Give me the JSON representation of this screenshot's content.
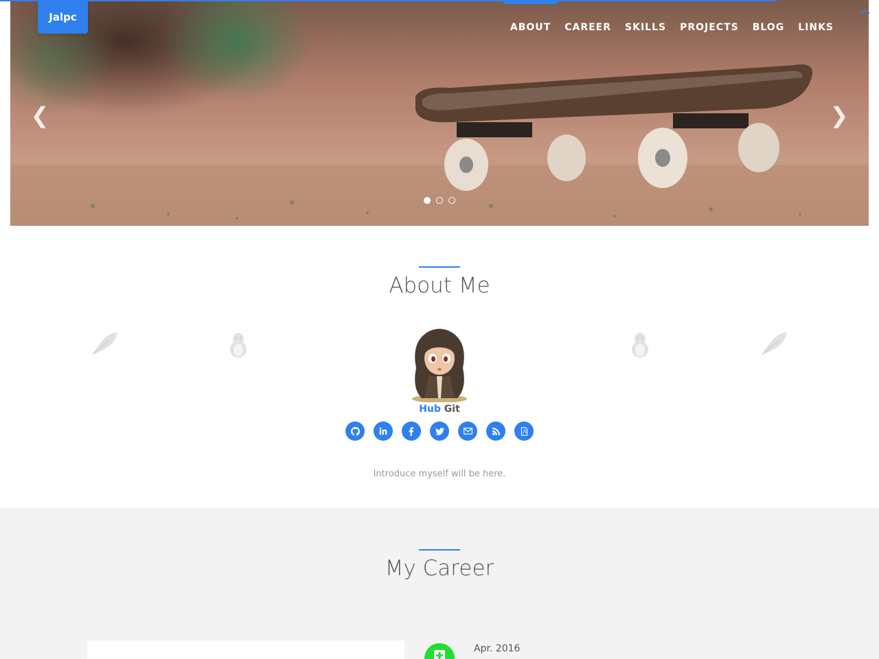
{
  "brand": {
    "label": "Jalpc"
  },
  "nav": {
    "items": [
      {
        "label": "ABOUT",
        "active": true
      },
      {
        "label": "CAREER"
      },
      {
        "label": "SKILLS"
      },
      {
        "label": "PROJECTS"
      },
      {
        "label": "BLOG"
      },
      {
        "label": "LINKS"
      }
    ]
  },
  "carousel": {
    "prev_icon": "chevron-left-icon",
    "next_icon": "chevron-right-icon",
    "slide_count": 3,
    "active_slide": 1
  },
  "about": {
    "title": "About Me",
    "name_part1": "Hub",
    "name_part2": "Git",
    "intro": "Introduce myself will be here.",
    "social_icons": [
      "github-icon",
      "linkedin-icon",
      "facebook-icon",
      "twitter-icon",
      "email-icon",
      "rss-icon",
      "pdf-icon"
    ]
  },
  "career": {
    "title": "My Career",
    "first_date": "Apr. 2016"
  },
  "colors": {
    "accent": "#2f80ed",
    "career_dot": "#22dd33",
    "career_bg": "#f3f3f3"
  }
}
